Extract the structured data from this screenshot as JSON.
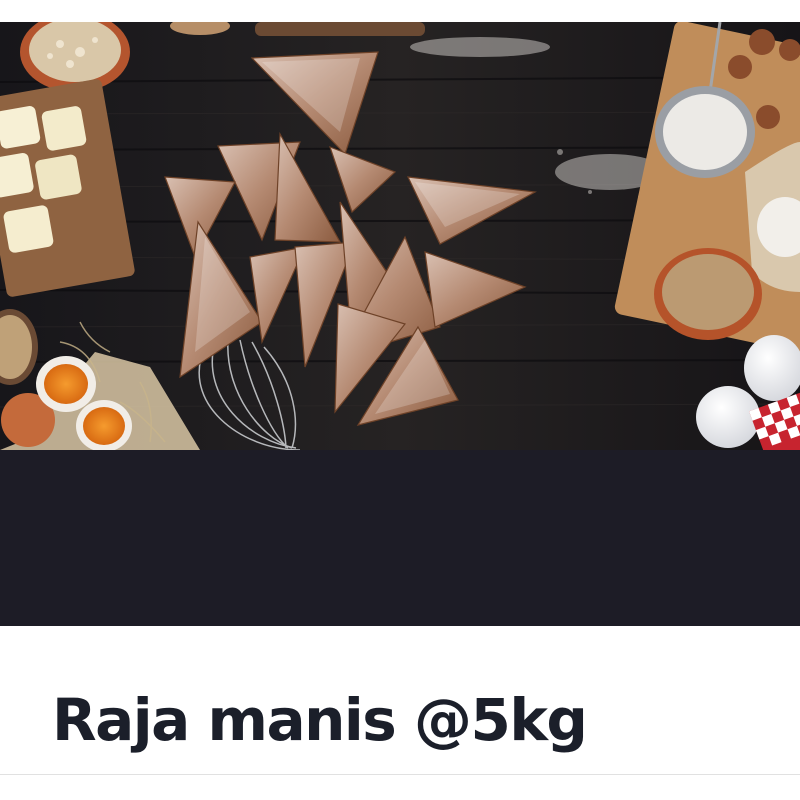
{
  "product": {
    "title": "Raja manis @5kg"
  },
  "photo": {
    "subject": "food-photo"
  },
  "colors": {
    "dark_band": "#1d1c26",
    "title_text": "#1b1f2a",
    "background": "#ffffff"
  }
}
